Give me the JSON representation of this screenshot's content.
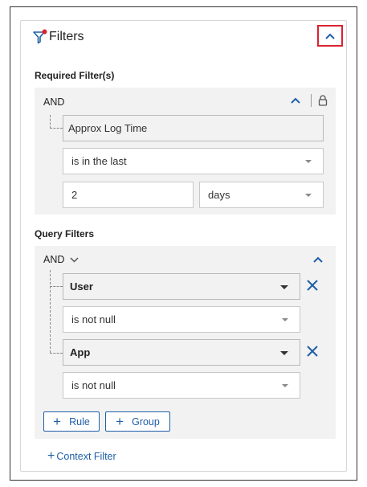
{
  "header": {
    "title": "Filters",
    "filter_icon": "filter-icon",
    "collapse_icon": "chevron-up-icon",
    "highlight_color": "#d9232e"
  },
  "required": {
    "section_label": "Required Filter(s)",
    "operator": "AND",
    "field": "Approx Log Time",
    "condition": "is in the last",
    "amount": "2",
    "unit": "days"
  },
  "query": {
    "section_label": "Query Filters",
    "operator": "AND",
    "rules": [
      {
        "field": "User",
        "condition": "is not null"
      },
      {
        "field": "App",
        "condition": "is not null"
      }
    ],
    "add_rule_label": "Rule",
    "add_group_label": "Group"
  },
  "context_filter_label": "Context Filter",
  "colors": {
    "accent": "#1f5fa6",
    "group_bg": "#f2f2f2",
    "border": "#c8c8c8"
  }
}
